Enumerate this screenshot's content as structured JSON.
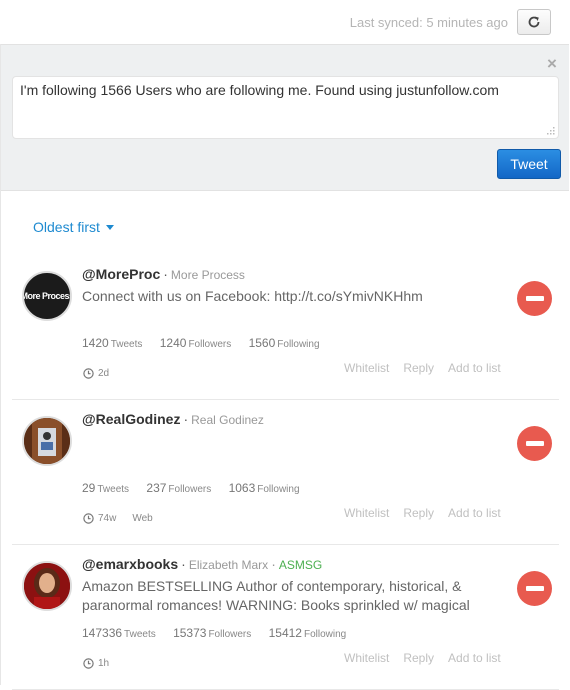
{
  "topbar": {
    "sync_text": "Last synced: 5 minutes ago",
    "refresh_icon": "refresh-icon"
  },
  "compose": {
    "close_label": "×",
    "tweet_text": "I'm following 1566 Users who are following me. Found using justunfollow.com",
    "tweet_button": "Tweet"
  },
  "sort": {
    "label": "Oldest first"
  },
  "users": [
    {
      "handle": "@MoreProc",
      "name": "More Process",
      "tag": "",
      "bio": "Connect with us on Facebook: http://t.co/sYmivNKHhm",
      "avatar_text": "More Process",
      "tweets": "1420",
      "tweets_label": "Tweets",
      "followers": "1240",
      "followers_label": "Followers",
      "following": "1560",
      "following_label": "Following",
      "time": "2d",
      "source": "",
      "actions": [
        "Whitelist",
        "Reply",
        "Add to list"
      ]
    },
    {
      "handle": "@RealGodinez",
      "name": "Real Godinez",
      "tag": "",
      "bio": "",
      "avatar_text": "",
      "tweets": "29",
      "tweets_label": "Tweets",
      "followers": "237",
      "followers_label": "Followers",
      "following": "1063",
      "following_label": "Following",
      "time": "74w",
      "source": "Web",
      "actions": [
        "Whitelist",
        "Reply",
        "Add to list"
      ]
    },
    {
      "handle": "@emarxbooks",
      "name": "Elizabeth Marx",
      "tag": "ASMSG",
      "bio": "Amazon BESTSELLING Author of contemporary, historical, & paranormal romances! WARNING: Books sprinkled w/ magical",
      "avatar_text": "",
      "tweets": "147336",
      "tweets_label": "Tweets",
      "followers": "15373",
      "followers_label": "Followers",
      "following": "15412",
      "following_label": "Following",
      "time": "1h",
      "source": "",
      "actions": [
        "Whitelist",
        "Reply",
        "Add to list"
      ]
    }
  ],
  "colors": {
    "accent": "#1e8ad0",
    "remove": "#e85a4f",
    "tag": "#4caf50"
  }
}
